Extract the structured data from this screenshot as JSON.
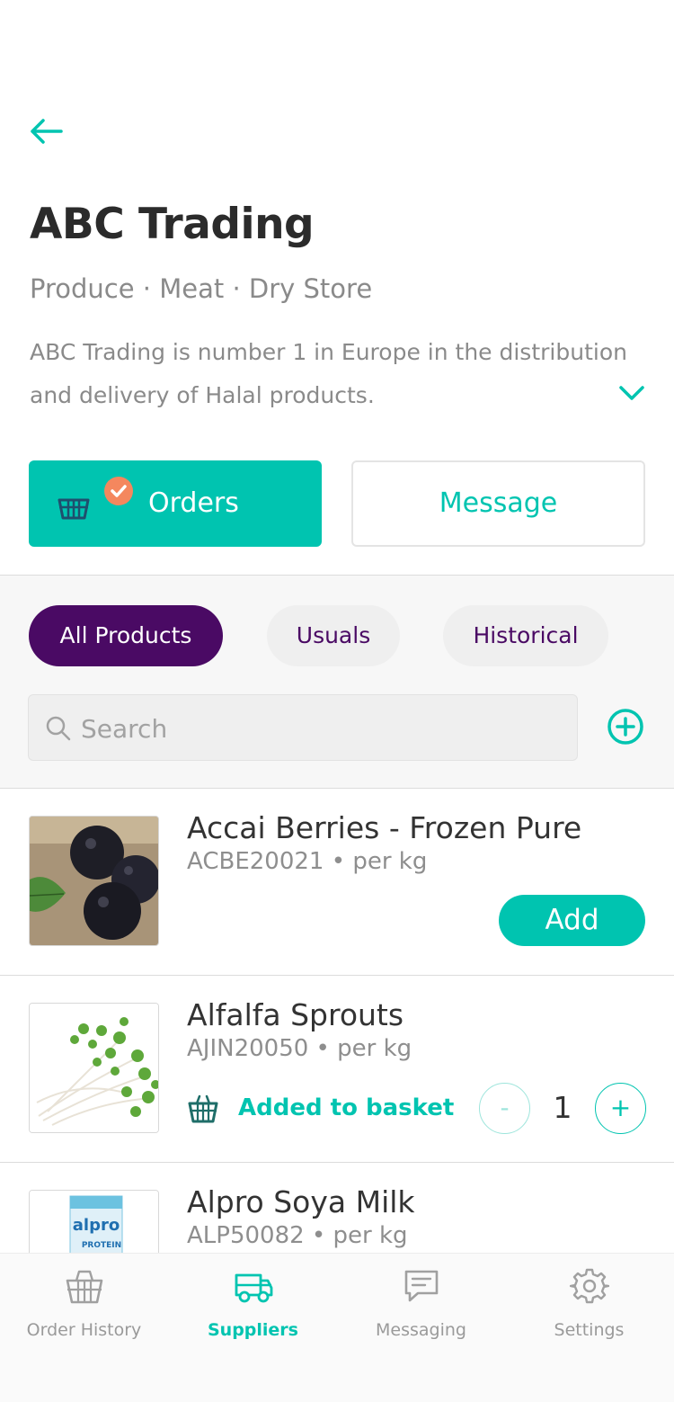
{
  "header": {
    "supplier_name": "ABC Trading",
    "categories": "Produce · Meat · Dry Store",
    "description": "ABC Trading is number 1 in Europe in the distribution and delivery of Halal products."
  },
  "actions": {
    "orders_label": "Orders",
    "message_label": "Message"
  },
  "filters": {
    "chips": [
      "All Products",
      "Usuals",
      "Historical"
    ],
    "active": "All Products"
  },
  "search": {
    "placeholder": "Search",
    "value": ""
  },
  "products": [
    {
      "name": "Accai Berries - Frozen Pure",
      "meta": "ACBE20021 • per kg",
      "action_label": "Add"
    },
    {
      "name": "Alfalfa Sprouts",
      "meta": "AJIN20050 • per kg",
      "status": "Added to basket",
      "quantity": "1",
      "minus": "-",
      "plus": "+"
    },
    {
      "name": "Alpro Soya Milk",
      "meta": "ALP50082 • per kg",
      "image_text": "alpro",
      "image_subtext": "PROTEIN"
    }
  ],
  "tabbar": {
    "items": [
      {
        "label": "Order History",
        "icon": "basket-icon"
      },
      {
        "label": "Suppliers",
        "icon": "truck-icon"
      },
      {
        "label": "Messaging",
        "icon": "message-icon"
      },
      {
        "label": "Settings",
        "icon": "gear-icon"
      }
    ],
    "active": "Suppliers"
  },
  "colors": {
    "accent": "#00c4b0",
    "chip_active": "#4a0a64",
    "badge": "#f4875e"
  }
}
